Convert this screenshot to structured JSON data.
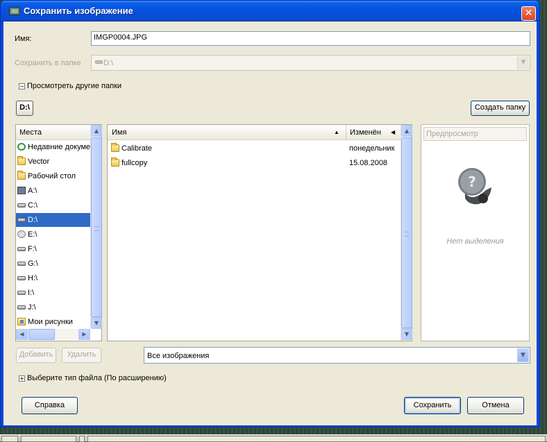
{
  "window": {
    "title": "Сохранить изображение",
    "close_glyph": "✕"
  },
  "name_field": {
    "label": "Имя:",
    "value": "IMGP0004.JPG"
  },
  "save_in": {
    "label": "Сохранить в папке",
    "value": "D:\\"
  },
  "browse_toggle": {
    "label": "Просмотреть другие папки",
    "glyph": "−"
  },
  "path_bar": {
    "current": "D:\\"
  },
  "create_folder_button": "Создать папку",
  "places": {
    "header": "Места",
    "items": [
      {
        "label": "Недавние докуме",
        "icon": "recent-icon"
      },
      {
        "label": "Vector",
        "icon": "folder-icon"
      },
      {
        "label": "Рабочий стол",
        "icon": "folder-icon"
      },
      {
        "label": "A:\\",
        "icon": "floppy-icon"
      },
      {
        "label": "C:\\",
        "icon": "drive-icon"
      },
      {
        "label": "D:\\",
        "icon": "drive-icon",
        "selected": true
      },
      {
        "label": "E:\\",
        "icon": "cd-icon"
      },
      {
        "label": "F:\\",
        "icon": "drive-icon"
      },
      {
        "label": "G:\\",
        "icon": "drive-icon"
      },
      {
        "label": "H:\\",
        "icon": "drive-icon"
      },
      {
        "label": "I:\\",
        "icon": "drive-icon"
      },
      {
        "label": "J:\\",
        "icon": "drive-icon"
      },
      {
        "label": "Мои рисунки",
        "icon": "pictures-icon"
      }
    ],
    "add_button": "Добавить",
    "remove_button": "Удалить"
  },
  "files": {
    "columns": {
      "name": "Имя",
      "modified": "Изменён"
    },
    "rows": [
      {
        "name": "Calibrate",
        "modified": "понедельник"
      },
      {
        "name": "fullcopy",
        "modified": "15.08.2008"
      }
    ]
  },
  "preview": {
    "header": "Предпросмотр",
    "empty_text": "Нет выделения"
  },
  "filter": {
    "value": "Все изображения"
  },
  "file_type_toggle": {
    "label": "Выберите тип файла (По расширению)",
    "glyph": "+"
  },
  "buttons": {
    "help": "Справка",
    "save": "Сохранить",
    "cancel": "Отмена"
  },
  "colors": {
    "titlebar": "#0550dc",
    "selection": "#316ac5",
    "dialog_bg": "#ece9d8"
  }
}
